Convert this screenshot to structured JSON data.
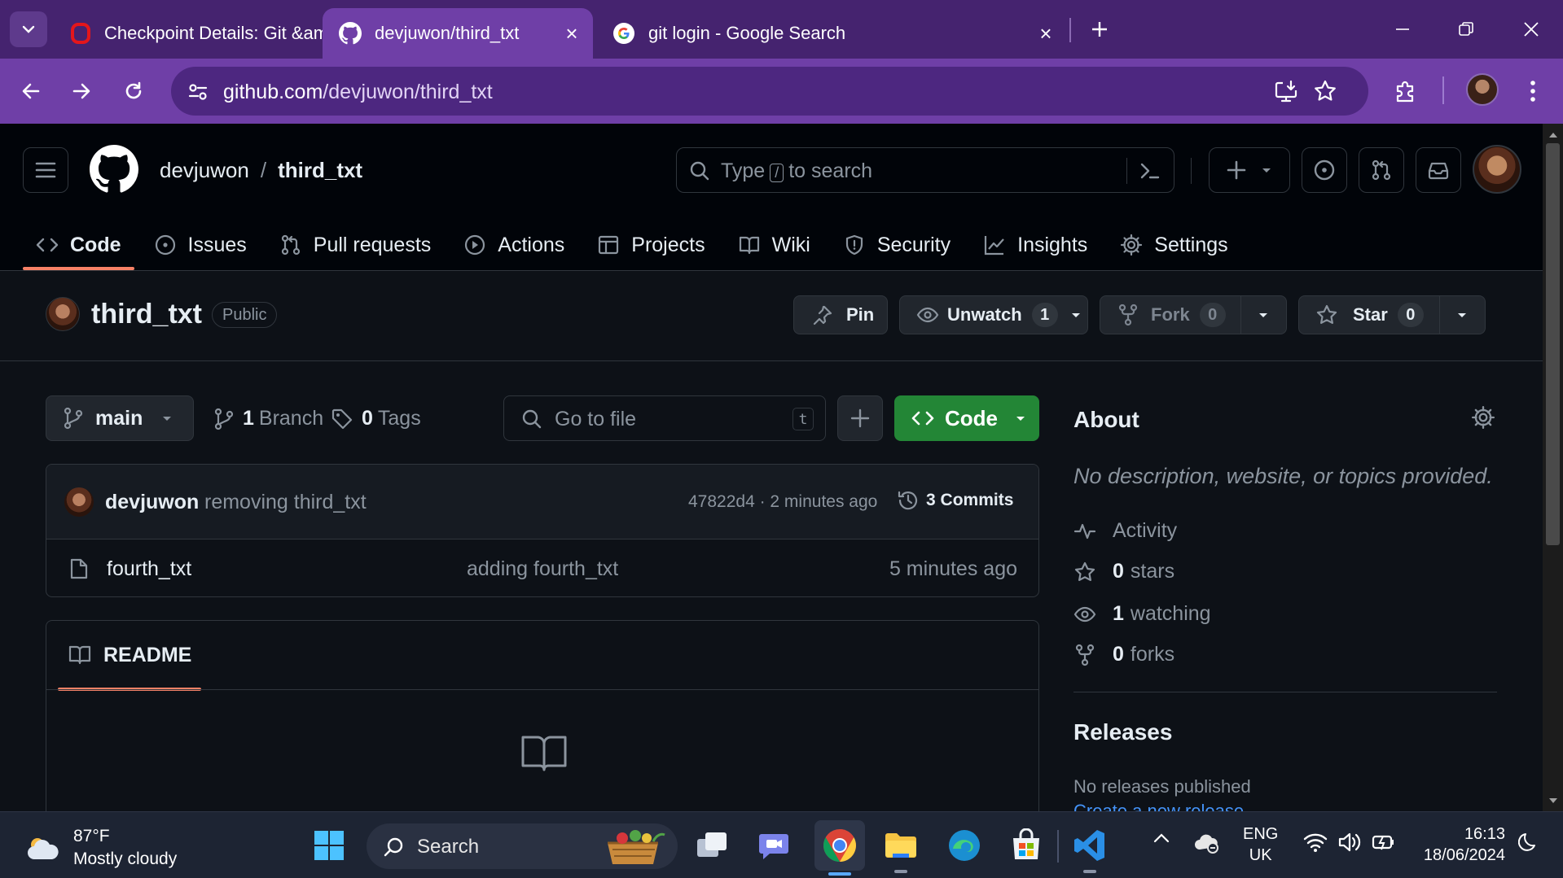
{
  "browser": {
    "tabs": [
      {
        "title": "Checkpoint Details: Git &amp; C",
        "active": false
      },
      {
        "title": "devjuwon/third_txt",
        "active": true
      },
      {
        "title": "git login - Google Search",
        "active": false
      }
    ],
    "url_host": "github.com",
    "url_path": "/devjuwon/third_txt"
  },
  "header": {
    "owner": "devjuwon",
    "separator": "/",
    "repo": "third_txt",
    "search_prefix": "Type",
    "search_key": "/",
    "search_suffix": "to search"
  },
  "repo_nav": [
    {
      "label": "Code",
      "icon": "code-icon",
      "selected": true
    },
    {
      "label": "Issues",
      "icon": "issue-icon"
    },
    {
      "label": "Pull requests",
      "icon": "pull-request-icon"
    },
    {
      "label": "Actions",
      "icon": "play-icon"
    },
    {
      "label": "Projects",
      "icon": "table-icon"
    },
    {
      "label": "Wiki",
      "icon": "book-icon"
    },
    {
      "label": "Security",
      "icon": "shield-icon"
    },
    {
      "label": "Insights",
      "icon": "graph-icon"
    },
    {
      "label": "Settings",
      "icon": "gear-icon"
    }
  ],
  "repo": {
    "title": "third_txt",
    "visibility": "Public",
    "pin_label": "Pin",
    "watch_label": "Unwatch",
    "watch_count": "1",
    "fork_label": "Fork",
    "fork_count": "0",
    "star_label": "Star",
    "star_count": "0"
  },
  "toolbar": {
    "branch": "main",
    "branch_count": "1",
    "branch_label": "Branch",
    "tag_count": "0",
    "tag_label": "Tags",
    "goto_placeholder": "Go to file",
    "goto_key": "t",
    "code_label": "Code"
  },
  "latest_commit": {
    "author": "devjuwon",
    "message": "removing third_txt",
    "sha_age": "47822d4 · 2 minutes ago",
    "commits_count": "3",
    "commits_label": "Commits"
  },
  "files": [
    {
      "name": "fourth_txt",
      "message": "adding fourth_txt",
      "age": "5 minutes ago"
    }
  ],
  "readme": {
    "tab_label": "README"
  },
  "about": {
    "title": "About",
    "description": "No description, website, or topics provided.",
    "activity_label": "Activity",
    "stars_count": "0",
    "stars_label": "stars",
    "watching_count": "1",
    "watching_label": "watching",
    "forks_count": "0",
    "forks_label": "forks"
  },
  "releases": {
    "title": "Releases",
    "none_text": "No releases published",
    "create_link": "Create a new release"
  },
  "taskbar": {
    "temperature": "87°F",
    "condition": "Mostly cloudy",
    "search_label": "Search",
    "lang_primary": "ENG",
    "lang_secondary": "UK",
    "time": "16:13",
    "date": "18/06/2024"
  },
  "colors": {
    "tab_strip": "#45236f",
    "toolbar": "#6f3fa7",
    "github_bg": "#0d1117",
    "header_bg": "#010409",
    "accent_underline": "#f78166",
    "code_button": "#238636",
    "link": "#4493f8"
  }
}
